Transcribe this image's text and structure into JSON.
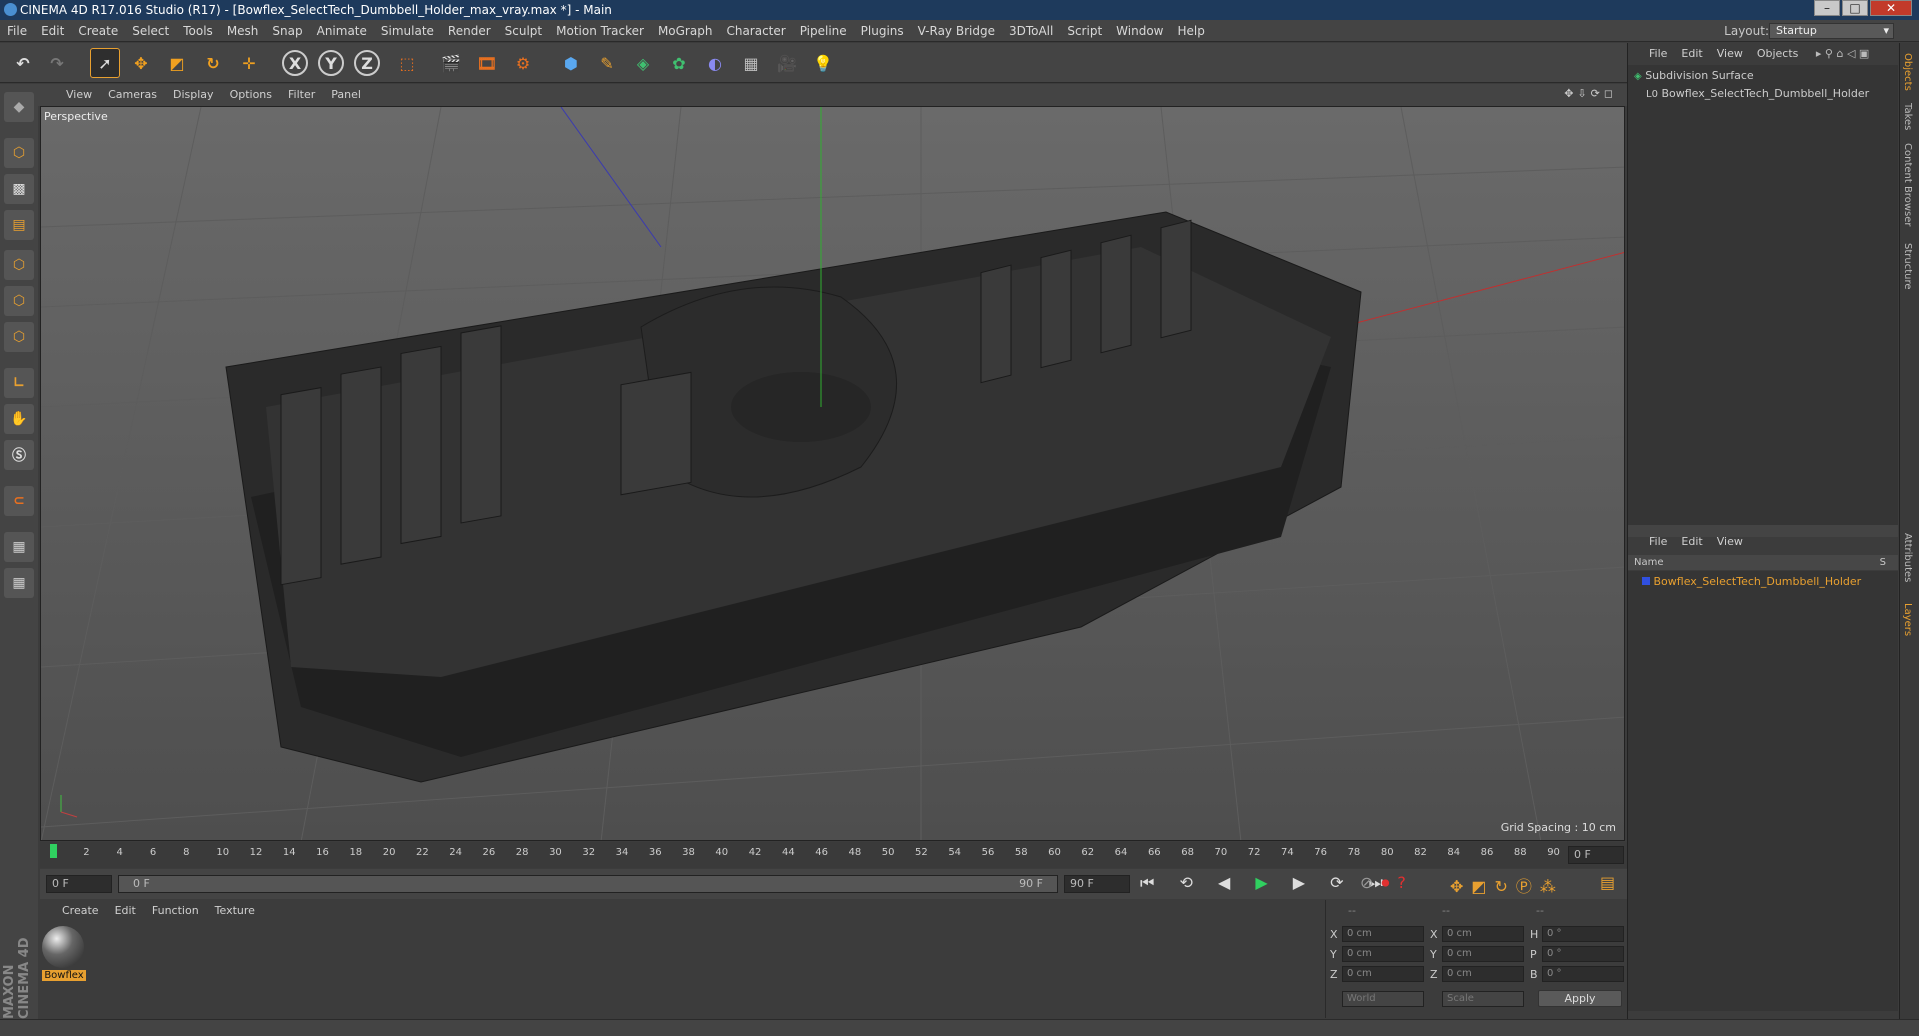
{
  "window": {
    "title": "CINEMA 4D R17.016 Studio (R17) - [Bowflex_SelectTech_Dumbbell_Holder_max_vray.max *] - Main",
    "minimize": "–",
    "maximize": "□",
    "close": "✕"
  },
  "menu": {
    "items": [
      "File",
      "Edit",
      "Create",
      "Select",
      "Tools",
      "Mesh",
      "Snap",
      "Animate",
      "Simulate",
      "Render",
      "Sculpt",
      "Motion Tracker",
      "MoGraph",
      "Character",
      "Pipeline",
      "Plugins",
      "V-Ray Bridge",
      "3DToAll",
      "Script",
      "Window",
      "Help"
    ],
    "layout_label": "Layout:",
    "layout_value": "Startup"
  },
  "toolbar": {
    "axis_x": "X",
    "axis_y": "Y",
    "axis_z": "Z"
  },
  "viewport": {
    "menu": [
      "View",
      "Cameras",
      "Display",
      "Options",
      "Filter",
      "Panel"
    ],
    "label": "Perspective",
    "grid_spacing": "Grid Spacing : 10 cm"
  },
  "timeline": {
    "ticks": [
      "0",
      "2",
      "4",
      "6",
      "8",
      "10",
      "12",
      "14",
      "16",
      "18",
      "20",
      "22",
      "24",
      "26",
      "28",
      "30",
      "32",
      "34",
      "36",
      "38",
      "40",
      "42",
      "44",
      "46",
      "48",
      "50",
      "52",
      "54",
      "56",
      "58",
      "60",
      "62",
      "64",
      "66",
      "68",
      "70",
      "72",
      "74",
      "76",
      "78",
      "80",
      "82",
      "84",
      "86",
      "88",
      "90"
    ],
    "end_field": "0 F",
    "current_frame": "0 F",
    "range_start": "0 F",
    "range_end": "90 F",
    "max_frame": "90 F"
  },
  "materials": {
    "menu": [
      "Create",
      "Edit",
      "Function",
      "Texture"
    ],
    "items": [
      {
        "name": "Bowflex"
      }
    ]
  },
  "coordinates": {
    "pos_x": "0 cm",
    "pos_y": "0 cm",
    "pos_z": "0 cm",
    "size_x": "0 cm",
    "size_y": "0 cm",
    "size_z": "0 cm",
    "rot_h": "0 °",
    "rot_p": "0 °",
    "rot_b": "0 °",
    "labels": {
      "x": "X",
      "y": "Y",
      "z": "Z",
      "h": "H",
      "p": "P",
      "b": "B"
    },
    "mode1": "World",
    "mode2": "Scale",
    "apply": "Apply",
    "header": [
      "--",
      "--",
      "--"
    ]
  },
  "object_manager": {
    "menu": [
      "File",
      "Edit",
      "View",
      "Objects"
    ],
    "objects": [
      {
        "name": "Subdivision Surface"
      },
      {
        "name": "Bowflex_SelectTech_Dumbbell_Holder"
      }
    ]
  },
  "layer_manager": {
    "menu": [
      "File",
      "Edit",
      "View"
    ],
    "col_name": "Name",
    "col_s": "S",
    "items": [
      {
        "name": "Bowflex_SelectTech_Dumbbell_Holder"
      }
    ]
  },
  "side_tabs": [
    "Objects",
    "Takes",
    "Content Browser",
    "Structure",
    "Attributes",
    "Layers"
  ],
  "branding": "MAXON CINEMA 4D"
}
